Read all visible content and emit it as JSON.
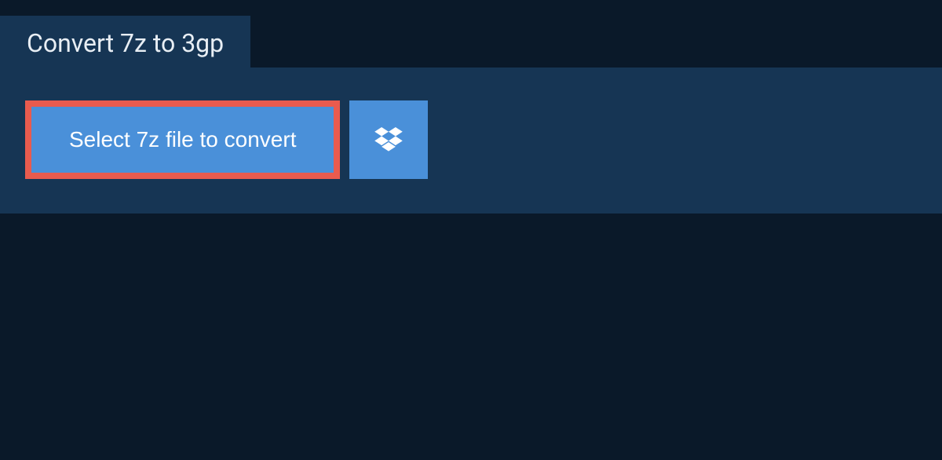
{
  "tab": {
    "title": "Convert 7z to 3gp"
  },
  "main": {
    "select_button_label": "Select 7z file to convert"
  },
  "colors": {
    "background": "#0a1929",
    "panel": "#163554",
    "accent": "#4a90d9",
    "highlight_border": "#e95b4e",
    "text_light": "#e8eef4"
  }
}
